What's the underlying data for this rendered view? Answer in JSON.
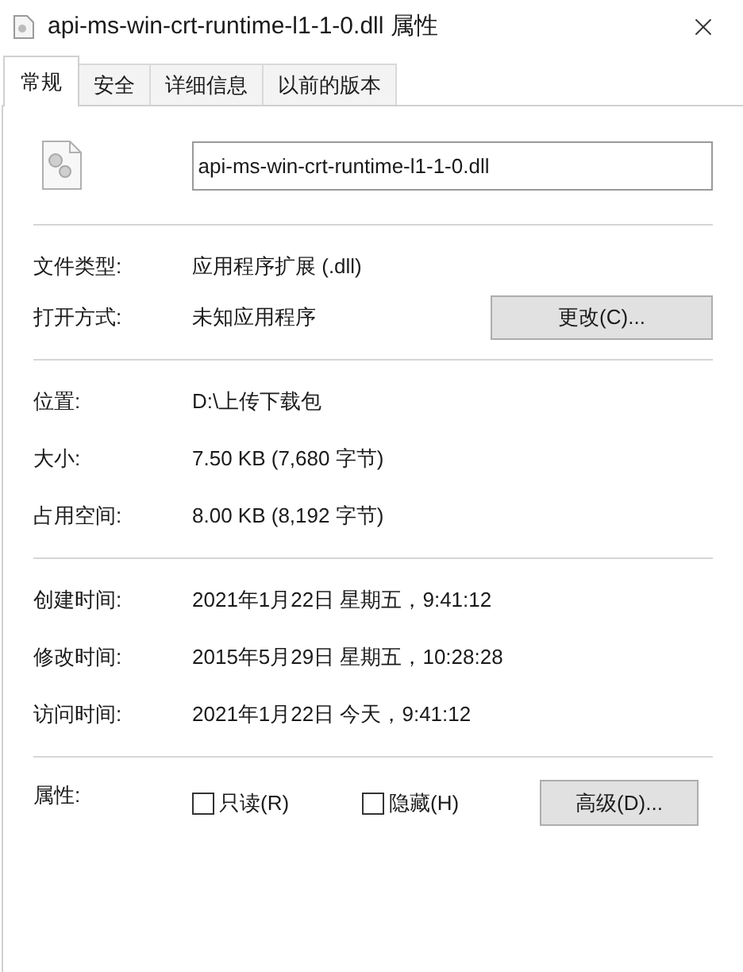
{
  "window": {
    "title": "api-ms-win-crt-runtime-l1-1-0.dll 属性"
  },
  "tabs": [
    {
      "label": "常规",
      "selected": true
    },
    {
      "label": "安全",
      "selected": false
    },
    {
      "label": "详细信息",
      "selected": false
    },
    {
      "label": "以前的版本",
      "selected": false
    }
  ],
  "file_name": {
    "value": "api-ms-win-crt-runtime-l1-1-0.dll"
  },
  "sections": [
    [
      {
        "label": "文件类型:",
        "value": "应用程序扩展 (.dll)"
      },
      {
        "label": "打开方式:",
        "value": "未知应用程序",
        "button": "更改(C)..."
      }
    ],
    [
      {
        "label": "位置:",
        "value": "D:\\上传下载包"
      },
      {
        "label": "大小:",
        "value": "7.50 KB (7,680 字节)"
      },
      {
        "label": "占用空间:",
        "value": "8.00 KB (8,192 字节)"
      }
    ],
    [
      {
        "label": "创建时间:",
        "value": "2021年1月22日 星期五，9:41:12"
      },
      {
        "label": "修改时间:",
        "value": "2015年5月29日 星期五，10:28:28"
      },
      {
        "label": "访问时间:",
        "value": "2021年1月22日 今天，9:41:12"
      }
    ]
  ],
  "attributes": {
    "label": "属性:",
    "checkboxes": [
      {
        "label": "只读(R)",
        "checked": false
      },
      {
        "label": "隐藏(H)",
        "checked": false
      }
    ],
    "button": "高级(D)..."
  }
}
